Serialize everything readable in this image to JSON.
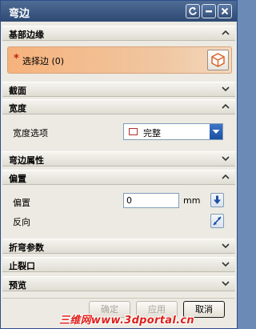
{
  "window": {
    "title": "弯边",
    "buttons": {
      "reset": "reset-icon",
      "minimize": "minimize-icon",
      "close": "close-icon"
    }
  },
  "sections": {
    "base_edge": {
      "label": "基部边缘",
      "state": "expanded"
    },
    "cross_section": {
      "label": "截面",
      "state": "collapsed"
    },
    "width": {
      "label": "宽度",
      "state": "expanded"
    },
    "flange_props": {
      "label": "弯边属性",
      "state": "collapsed"
    },
    "offset": {
      "label": "偏置",
      "state": "expanded"
    },
    "bend_params": {
      "label": "折弯参数",
      "state": "collapsed"
    },
    "relief": {
      "label": "止裂口",
      "state": "collapsed"
    },
    "preview": {
      "label": "预览",
      "state": "collapsed"
    }
  },
  "base_edge": {
    "required_mark": "*",
    "select_label": "选择边 (0)"
  },
  "width": {
    "option_label": "宽度选项",
    "option_value": "完整"
  },
  "offset": {
    "label": "偏置",
    "value": "0",
    "unit": "mm",
    "reverse_label": "反向"
  },
  "footer": {
    "ok": "确定",
    "apply": "应用",
    "cancel": "取消"
  },
  "watermark": "三维网www.3dportal.cn",
  "colors": {
    "title_bar": "#3b5a85",
    "selection_highlight": "#f6b27c",
    "required_star": "#c61e14",
    "dropdown_arrow": "#1c4fa0"
  }
}
